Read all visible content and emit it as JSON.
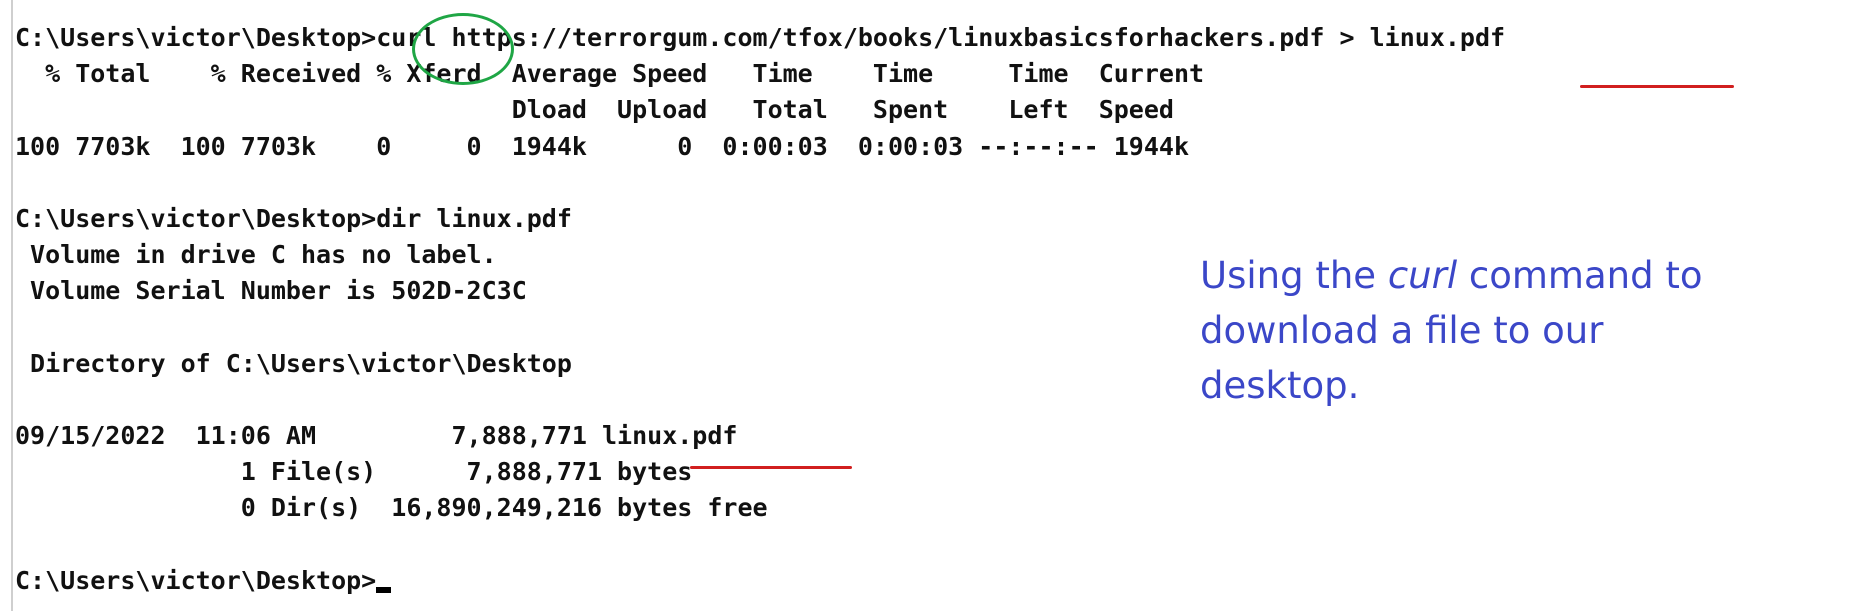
{
  "terminal": {
    "lines": [
      "C:\\Users\\victor\\Desktop>curl https://terrorgum.com/tfox/books/linuxbasicsforhackers.pdf > linux.pdf",
      "  % Total    % Received % Xferd  Average Speed   Time    Time     Time  Current",
      "                                 Dload  Upload   Total   Spent    Left  Speed",
      "100 7703k  100 7703k    0     0  1944k      0  0:00:03  0:00:03 --:--:-- 1944k",
      "",
      "C:\\Users\\victor\\Desktop>dir linux.pdf",
      " Volume in drive C has no label.",
      " Volume Serial Number is 502D-2C3C",
      "",
      " Directory of C:\\Users\\victor\\Desktop",
      "",
      "09/15/2022  11:06 AM         7,888,771 linux.pdf",
      "               1 File(s)      7,888,771 bytes",
      "               0 Dir(s)  16,890,249,216 bytes free",
      "",
      "C:\\Users\\victor\\Desktop>"
    ]
  },
  "caption": {
    "before": "Using the ",
    "emphasis": "curl",
    "after": " command to download a file to our desktop."
  },
  "annotations": {
    "circle_color": "#1fa645",
    "underline_color": "#d11f1f",
    "caption_color": "#3b47c8"
  }
}
